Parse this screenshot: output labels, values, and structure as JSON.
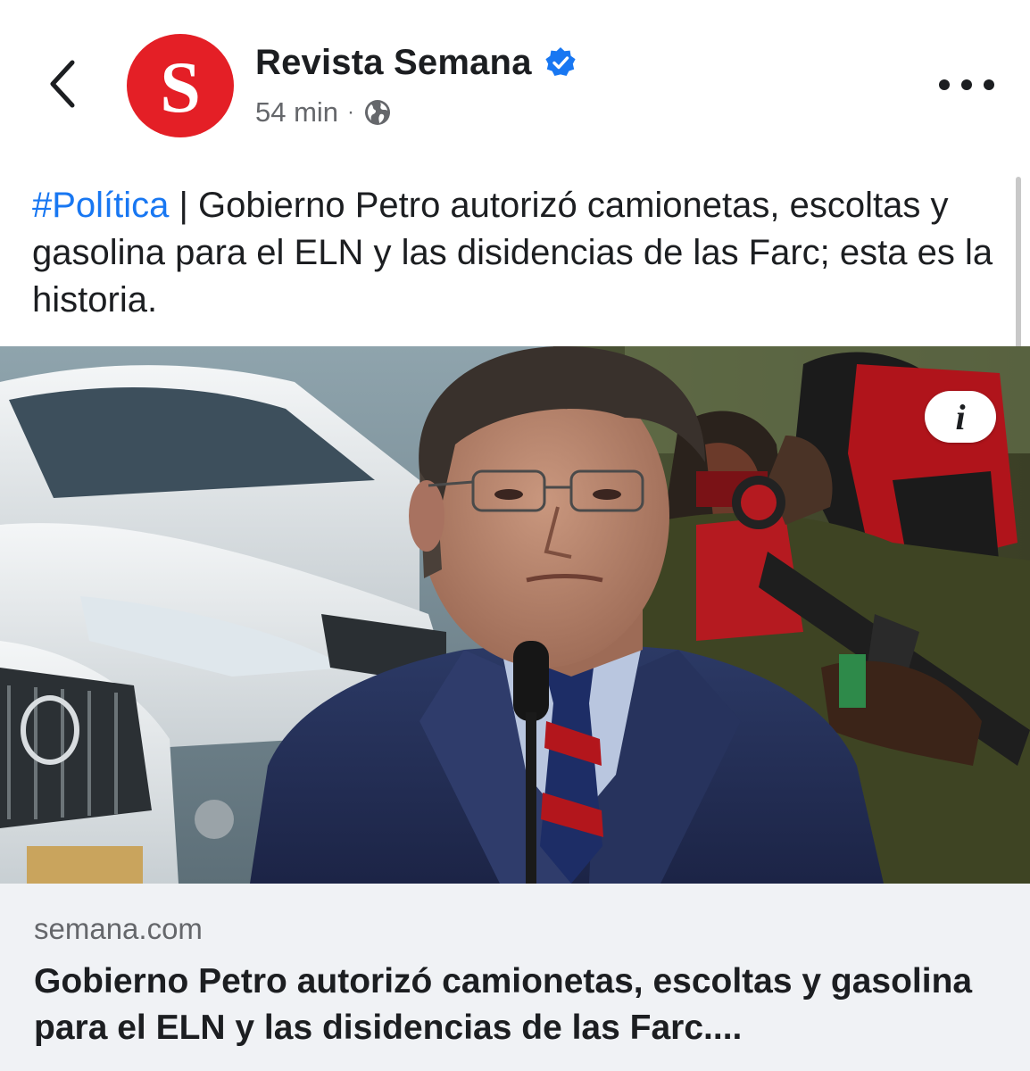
{
  "header": {
    "page_name": "Revista Semana",
    "avatar_letter": "S",
    "timestamp": "54 min",
    "separator": "·",
    "icons": {
      "back": "chevron-left-icon",
      "verified": "verified-badge-icon",
      "audience": "globe-icon",
      "more": "more-horizontal-icon"
    }
  },
  "post": {
    "hashtag": "#Política",
    "text": " | Gobierno Petro autorizó camionetas, escoltas y gasolina para el ELN y las disidencias de las Farc; esta es la historia."
  },
  "link_preview": {
    "info_label": "i",
    "domain": "semana.com",
    "title": "Gobierno Petro autorizó camionetas, escoltas y gasolina para el ELN y las disidencias de las Farc...."
  },
  "colors": {
    "brand_red": "#e41f26",
    "link_blue": "#1877f2",
    "text_primary": "#1c1e21",
    "text_secondary": "#65676b",
    "footer_bg": "#f0f2f5"
  }
}
